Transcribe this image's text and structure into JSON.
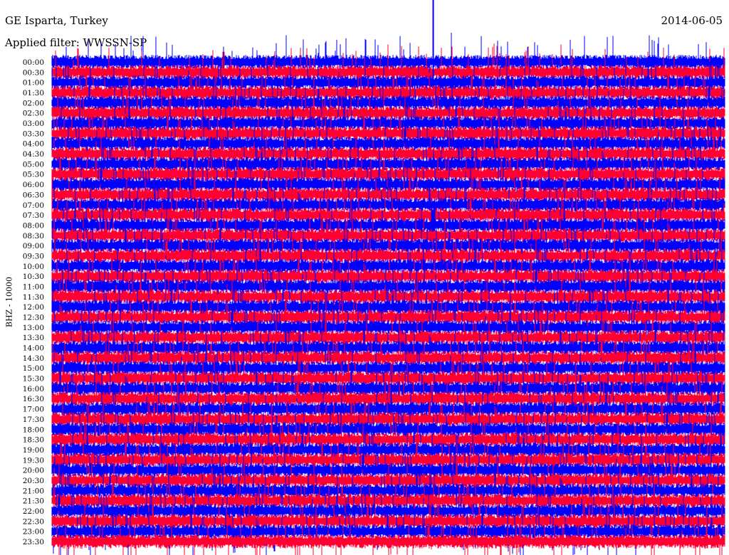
{
  "chart_data": {
    "type": "line",
    "title": "GE Isparta, Turkey",
    "date": "2014-06-05",
    "filter_label": "Applied filter: WWSSN-SP",
    "ylabel": "BHZ - 10000",
    "xlabel": "",
    "row_labels": [
      "00:00",
      "00:30",
      "01:00",
      "01:30",
      "02:00",
      "02:30",
      "03:00",
      "03:30",
      "04:00",
      "04:30",
      "05:00",
      "05:30",
      "06:00",
      "06:30",
      "07:00",
      "07:30",
      "08:00",
      "08:30",
      "09:00",
      "09:30",
      "10:00",
      "10:30",
      "11:00",
      "11:30",
      "12:00",
      "12:30",
      "13:00",
      "13:30",
      "14:00",
      "14:30",
      "15:00",
      "15:30",
      "16:00",
      "16:30",
      "17:00",
      "17:30",
      "18:00",
      "18:30",
      "19:00",
      "19:30",
      "20:00",
      "20:30",
      "21:00",
      "21:30",
      "22:00",
      "22:30",
      "23:00",
      "23:30"
    ],
    "row_minutes": 30,
    "series_colors": [
      "#0000ff",
      "#ff0033"
    ],
    "grid": false,
    "event_minute_in_row": 17
  }
}
